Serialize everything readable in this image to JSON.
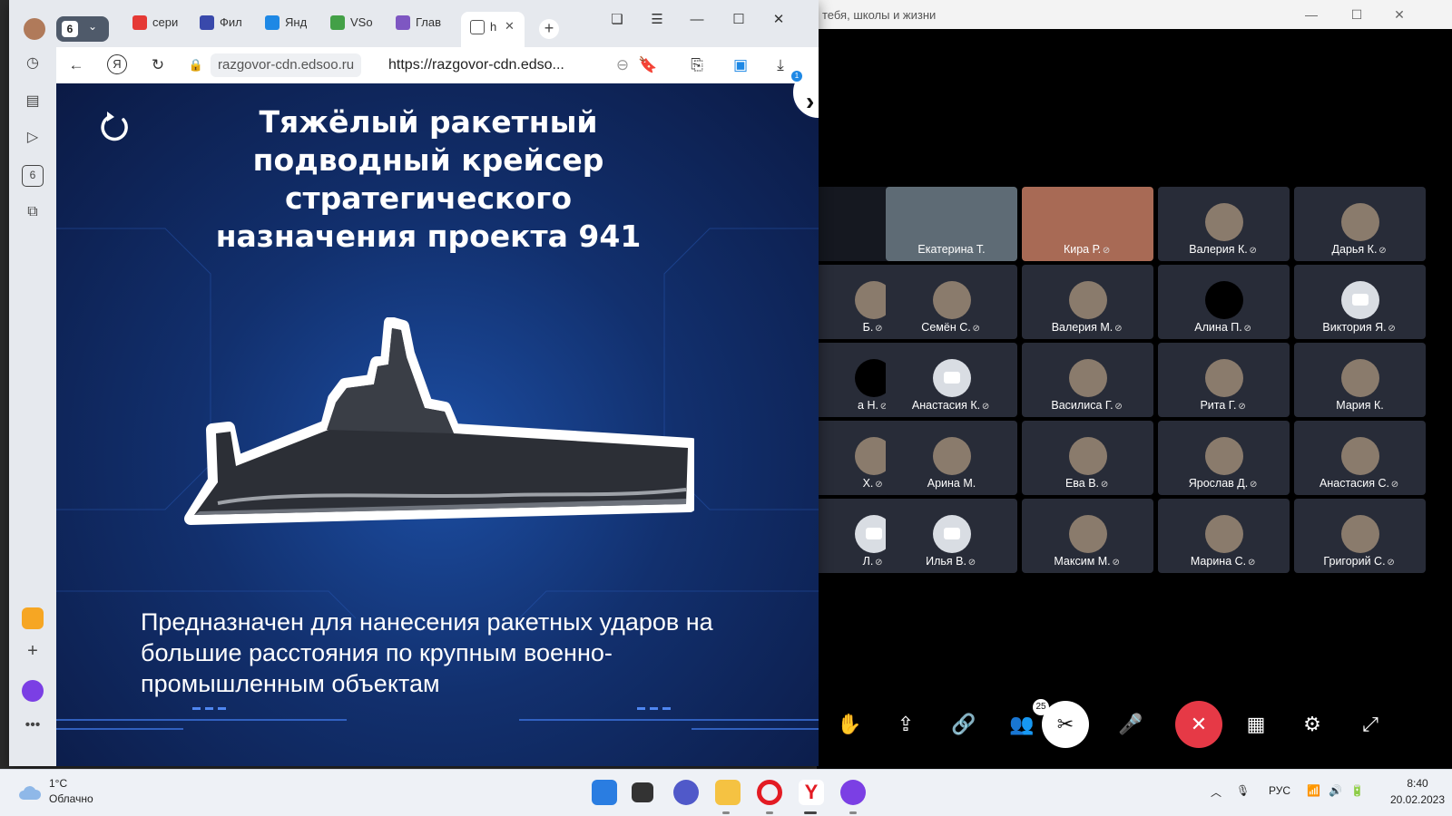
{
  "conference": {
    "window_title": "тебя, школы и жизни",
    "participants_count": "25",
    "participants": [
      {
        "name": "",
        "muted": false,
        "avatar": "screen"
      },
      {
        "name": "Екатерина Т.",
        "muted": false,
        "avatar": "photo"
      },
      {
        "name": "Кира Р.",
        "muted": true,
        "avatar": "photo"
      },
      {
        "name": "Валерия К.",
        "muted": true,
        "avatar": "photo"
      },
      {
        "name": "Дарья К.",
        "muted": true,
        "avatar": "photo"
      },
      {
        "name": "Б.",
        "muted": true,
        "avatar": "photo"
      },
      {
        "name": "Семён С.",
        "muted": true,
        "avatar": "photo"
      },
      {
        "name": "Валерия М.",
        "muted": true,
        "avatar": "photo"
      },
      {
        "name": "Алина П.",
        "muted": true,
        "avatar": "dark"
      },
      {
        "name": "Виктория Я.",
        "muted": true,
        "avatar": "camera"
      },
      {
        "name": "а Н.",
        "muted": true,
        "avatar": "dark"
      },
      {
        "name": "Анастасия К.",
        "muted": true,
        "avatar": "camera"
      },
      {
        "name": "Василиса Г.",
        "muted": true,
        "avatar": "photo"
      },
      {
        "name": "Рита Г.",
        "muted": true,
        "avatar": "photo"
      },
      {
        "name": "Мария К.",
        "muted": false,
        "avatar": "photo"
      },
      {
        "name": "Х.",
        "muted": true,
        "avatar": "photo"
      },
      {
        "name": "Арина М.",
        "muted": false,
        "avatar": "photo"
      },
      {
        "name": "Ева В.",
        "muted": true,
        "avatar": "photo"
      },
      {
        "name": "Ярослав Д.",
        "muted": true,
        "avatar": "photo"
      },
      {
        "name": "Анастасия С.",
        "muted": true,
        "avatar": "photo"
      },
      {
        "name": "Л.",
        "muted": true,
        "avatar": "camera"
      },
      {
        "name": "Илья В.",
        "muted": true,
        "avatar": "camera"
      },
      {
        "name": "Максим М.",
        "muted": true,
        "avatar": "photo"
      },
      {
        "name": "Марина С.",
        "muted": true,
        "avatar": "photo"
      },
      {
        "name": "Григорий С.",
        "muted": true,
        "avatar": "photo"
      }
    ]
  },
  "browser": {
    "tab_count": "6",
    "tabs": [
      {
        "label": "сери",
        "favicon_color": "#e53935"
      },
      {
        "label": "Фил",
        "favicon_color": "#3949ab"
      },
      {
        "label": "Янд",
        "favicon_color": "#1e88e5"
      },
      {
        "label": "VSo",
        "favicon_color": "#43a047"
      },
      {
        "label": "Глав",
        "favicon_color": "#7e57c2"
      },
      {
        "label": "h",
        "favicon_color": "#ffffff"
      }
    ],
    "domain": "razgovor-cdn.edsoo.ru",
    "url": "https://razgovor-cdn.edso...",
    "downloads_badge": "1",
    "sidebar_badge": "6"
  },
  "slide": {
    "title": "Тяжёлый ракетный подводный крейсер стратегического назначения проекта 941",
    "description": "Предназначен для нанесения ракетных ударов на большие расстояния по крупным военно-промышленным объектам"
  },
  "taskbar": {
    "weather_temp": "1°C",
    "weather_desc": "Облачно",
    "language": "РУС",
    "time": "8:40",
    "date": "20.02.2023"
  },
  "colors": {
    "end_call": "#e63946",
    "slide_bg": "#12306e",
    "conf_bg": "#000000"
  }
}
